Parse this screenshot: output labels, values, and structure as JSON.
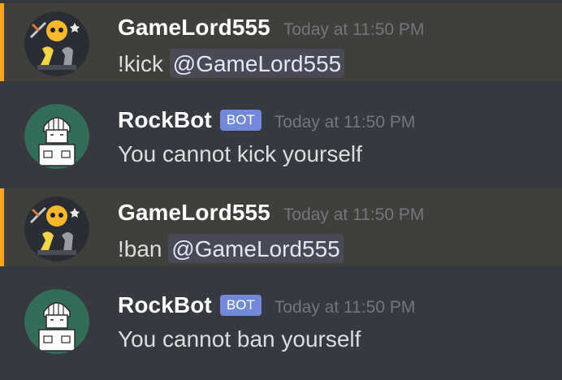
{
  "messages": [
    {
      "username": "GameLord555",
      "timestamp": "Today at 11:50 PM",
      "command": "!kick",
      "mention": "@GameLord555",
      "avatar": "gamelord-avatar",
      "highlighted": true
    },
    {
      "username": "RockBot",
      "bot_tag": "BOT",
      "timestamp": "Today at 11:50 PM",
      "text": "You cannot kick yourself",
      "avatar": "rockbot-avatar"
    },
    {
      "username": "GameLord555",
      "timestamp": "Today at 11:50 PM",
      "command": "!ban",
      "mention": "@GameLord555",
      "avatar": "gamelord-avatar",
      "highlighted": true
    },
    {
      "username": "RockBot",
      "bot_tag": "BOT",
      "timestamp": "Today at 11:50 PM",
      "text": "You cannot ban yourself",
      "avatar": "rockbot-avatar"
    }
  ],
  "colors": {
    "background": "#36393f",
    "mention_highlight": "#413f3b",
    "mention_border": "#faa61a",
    "bot_tag": "#7289da",
    "timestamp": "#72767d"
  }
}
